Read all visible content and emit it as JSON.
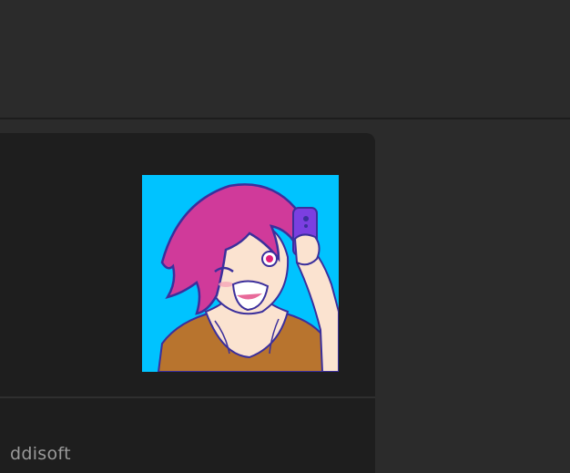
{
  "brand": {
    "name": "ddisoft"
  },
  "thumbnail": {
    "icon": "avatar-illustration"
  },
  "colors": {
    "background": "#2b2b2b",
    "panel": "#1e1e1e",
    "thumb_bg": "#00c3ff",
    "brand_text": "#9a9a9a"
  }
}
